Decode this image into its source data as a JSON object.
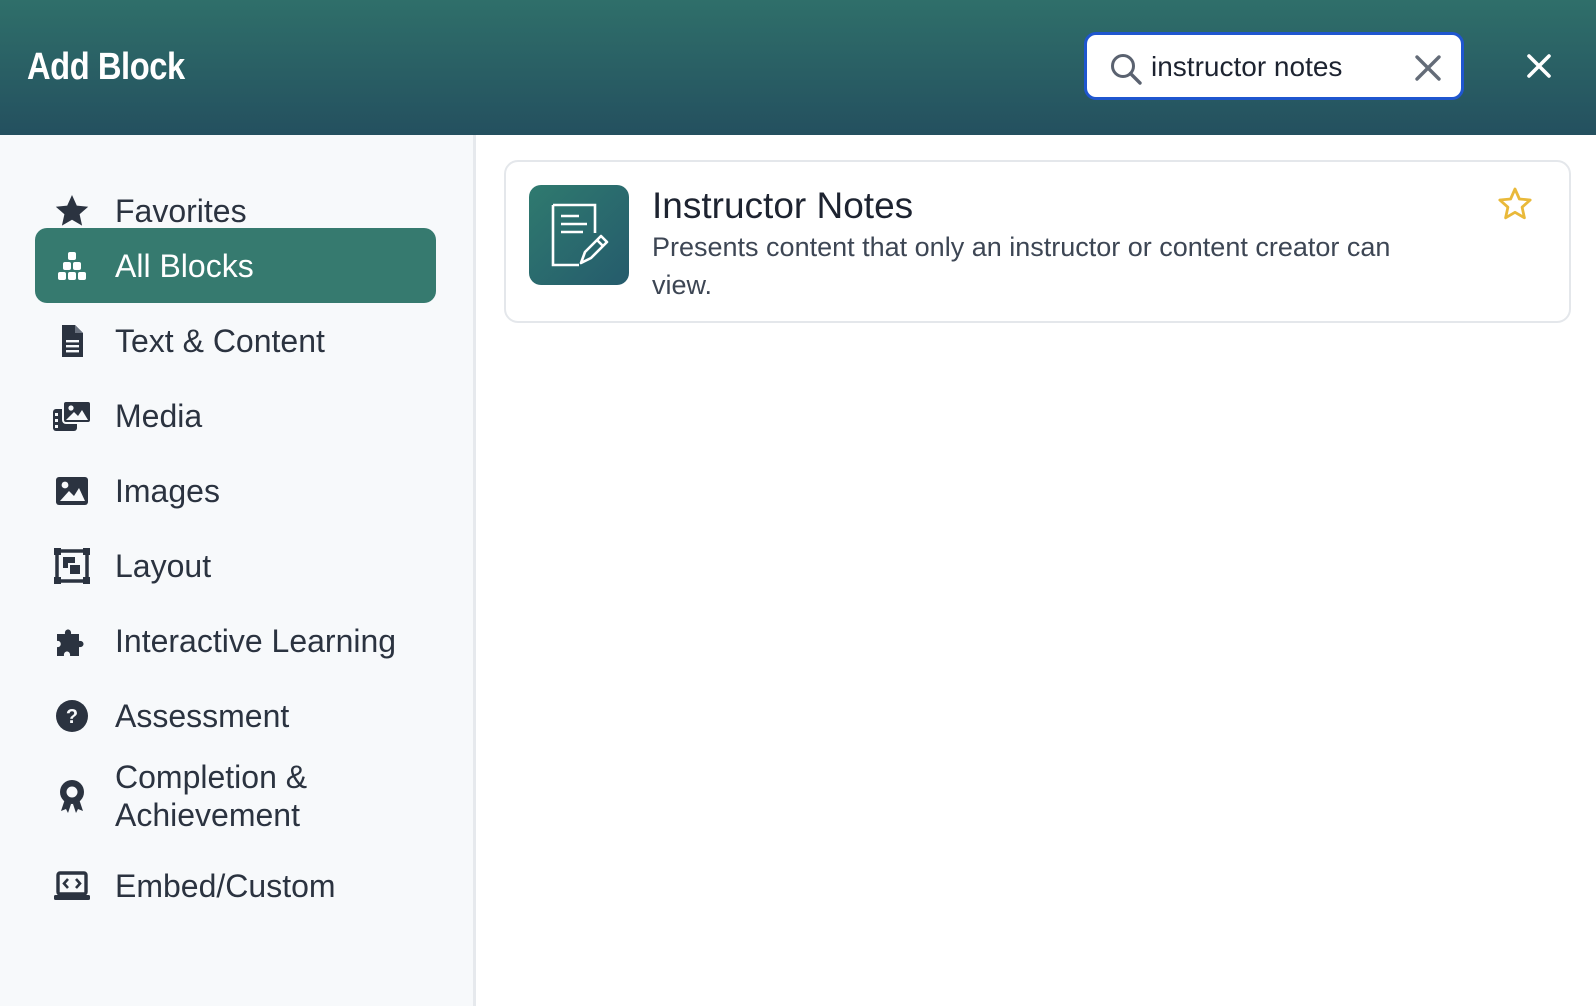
{
  "header": {
    "title": "Add Block",
    "search": {
      "value": "instructor notes",
      "placeholder": ""
    }
  },
  "sidebar": {
    "items": [
      {
        "label": "Favorites",
        "icon": "star-icon",
        "active": false
      },
      {
        "label": "All Blocks",
        "icon": "blocks-icon",
        "active": true
      },
      {
        "label": "Text & Content",
        "icon": "document-icon",
        "active": false
      },
      {
        "label": "Media",
        "icon": "media-icon",
        "active": false
      },
      {
        "label": "Images",
        "icon": "image-icon",
        "active": false
      },
      {
        "label": "Layout",
        "icon": "layout-icon",
        "active": false
      },
      {
        "label": "Interactive Learning",
        "icon": "puzzle-icon",
        "active": false
      },
      {
        "label": "Assessment",
        "icon": "question-icon",
        "active": false
      },
      {
        "label": "Completion &\nAchievement",
        "icon": "award-icon",
        "active": false
      },
      {
        "label": "Embed/Custom",
        "icon": "code-laptop-icon",
        "active": false
      }
    ]
  },
  "results": [
    {
      "title": "Instructor Notes",
      "description": "Presents content that only an instructor or content creator can view.",
      "icon": "note-edit-icon",
      "favorited": false
    }
  ],
  "colors": {
    "header_top": "#2f6f6a",
    "header_bottom": "#24505f",
    "active_nav": "#367a6f",
    "search_border": "#1f56cf",
    "star": "#e9b93a"
  }
}
